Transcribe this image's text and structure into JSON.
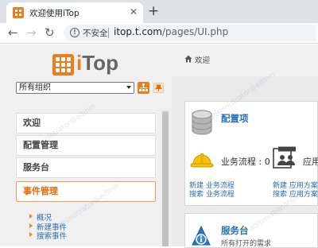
{
  "browser": {
    "tab_title": "欢迎使用iTop",
    "tab_close": "✕",
    "new_tab": "+",
    "security_label": "不安全",
    "url_host": "itop.t.com",
    "url_path": "/pages/UI.php"
  },
  "logo": {
    "text_i": "i",
    "text_rest": "Top"
  },
  "org_selector": {
    "value": "所有组织"
  },
  "menu": [
    {
      "label": "欢迎"
    },
    {
      "label": "配置管理"
    },
    {
      "label": "服务台"
    },
    {
      "label": "事件管理"
    }
  ],
  "submenu": [
    {
      "label": "概况"
    },
    {
      "label": "新建事件"
    },
    {
      "label": "搜索事件"
    }
  ],
  "breadcrumb": {
    "label": "欢迎"
  },
  "config_card": {
    "title": "配置项",
    "business_process_label": "业务流程 : 0",
    "app_label": "应用",
    "link_new_bp": "新建 业务流程",
    "link_search_bp": "搜索 业务流程",
    "link_new_app": "新建 应用方案",
    "link_search_app": "搜索 应用方案"
  },
  "service_card": {
    "title": "服务台",
    "subtitle": "所有打开的需求"
  },
  "watermark": {
    "text": "administrator@admin"
  },
  "colors": {
    "accent": "#ea7d1e",
    "link": "#2d6db0",
    "active_menu": "#e36c0a"
  }
}
